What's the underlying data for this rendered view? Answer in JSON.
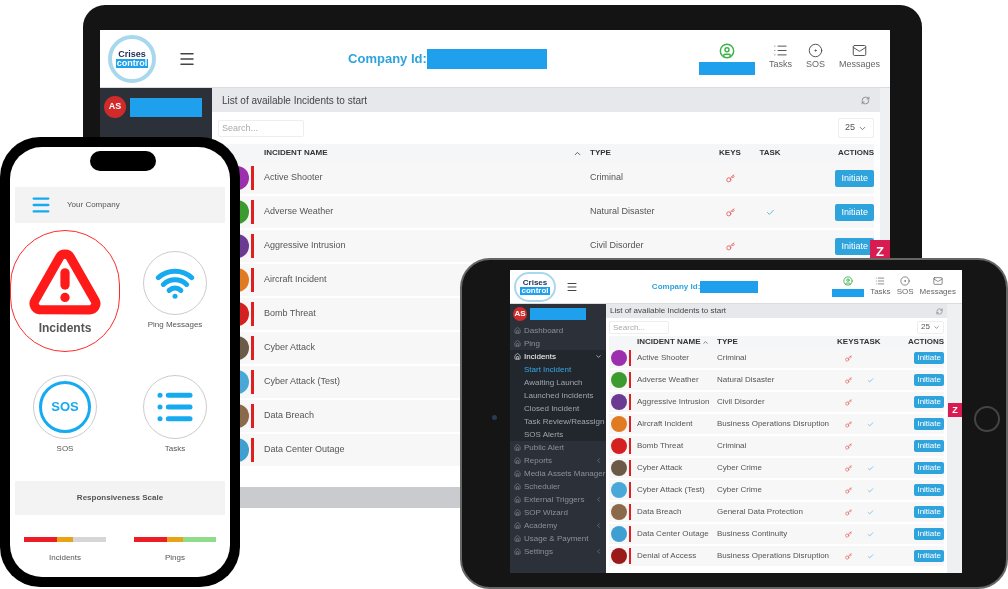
{
  "laptop": {
    "logo_text": [
      "Crises",
      "control"
    ],
    "company_label": "Company Id:",
    "nav": [
      {
        "kind": "user"
      },
      {
        "kind": "tasks",
        "label": "Tasks"
      },
      {
        "kind": "sos",
        "label": "SOS"
      },
      {
        "kind": "messages",
        "label": "Messages"
      }
    ],
    "user": {
      "initials": "AS"
    },
    "panel": {
      "title": "List of available Incidents to start",
      "search_placeholder": "Search...",
      "page_size": "25"
    },
    "columns": [
      "INCIDENT NAME",
      "TYPE",
      "KEYS",
      "TASK",
      "ACTIONS"
    ],
    "rows": [
      {
        "name": "Active Shooter",
        "color": "#9b2fae",
        "type": "Criminal",
        "key": true,
        "task": false,
        "action": "Initiate"
      },
      {
        "name": "Adverse Weather",
        "color": "#3c9b2e",
        "type": "Natural Disaster",
        "key": true,
        "task": true,
        "action": "Initiate"
      },
      {
        "name": "Aggressive Intrusion",
        "color": "#6b3b92",
        "type": "Civil Disorder",
        "key": true,
        "task": false,
        "action": "Initiate"
      },
      {
        "name": "Aircraft Incident",
        "color": "#e07b22"
      },
      {
        "name": "Bomb Threat",
        "color": "#d42020"
      },
      {
        "name": "Cyber Attack",
        "color": "#6b5a48"
      },
      {
        "name": "Cyber Attack (Test)",
        "color": "#4aa8d8"
      },
      {
        "name": "Data Breach",
        "color": "#8a6a4a"
      },
      {
        "name": "Data Center Outage",
        "color": "#3f9fd0"
      }
    ],
    "widget": "Z"
  },
  "phone": {
    "company": "Your Company",
    "tiles": [
      {
        "kind": "incidents",
        "label": "Incidents",
        "selected": true
      },
      {
        "kind": "ping",
        "label": "Ping Messages",
        "selected": false
      },
      {
        "kind": "sos",
        "label": "SOS",
        "icon_text": "SOS",
        "selected": false
      },
      {
        "kind": "tasks",
        "label": "Tasks",
        "selected": false
      }
    ],
    "scale_title": "Responsiveness Scale",
    "scales": [
      {
        "label": "Incidents",
        "color": "#d6d6d6",
        "fills": [
          {
            "color": "#ee1c25",
            "level": 0.4
          },
          {
            "color": "#e8a317",
            "level": 0.6
          }
        ]
      },
      {
        "label": "Pings",
        "color": "#8fdc8a",
        "fills": [
          {
            "color": "#ee1c25",
            "level": 0.4
          },
          {
            "color": "#e8a317",
            "level": 0.6
          }
        ]
      }
    ]
  },
  "tablet": {
    "logo_text": [
      "Crises",
      "control"
    ],
    "company_label": "Company Id:",
    "nav": [
      {
        "kind": "user"
      },
      {
        "kind": "tasks",
        "label": "Tasks"
      },
      {
        "kind": "sos",
        "label": "SOS"
      },
      {
        "kind": "messages",
        "label": "Messages"
      }
    ],
    "user": {
      "initials": "AS"
    },
    "menu": [
      {
        "label": "Dashboard"
      },
      {
        "label": "Ping"
      },
      {
        "label": "Incidents",
        "expanded": true,
        "children": [
          {
            "label": "Start Incident",
            "selected": true
          },
          {
            "label": "Awaiting Launch",
            "selected": false
          },
          {
            "label": "Launched Incidents",
            "selected": false
          },
          {
            "label": "Closed Incident",
            "selected": false
          },
          {
            "label": "Task Review/Reassign",
            "selected": false
          },
          {
            "label": "SOS Alerts",
            "selected": false
          }
        ]
      },
      {
        "label": "Public Alert"
      },
      {
        "label": "Reports",
        "expanded": false
      },
      {
        "label": "Media Assets Manager"
      },
      {
        "label": "Scheduler"
      },
      {
        "label": "External Triggers",
        "expanded": false
      },
      {
        "label": "SOP Wizard"
      },
      {
        "label": "Academy",
        "expanded": false
      },
      {
        "label": "Usage & Payment"
      },
      {
        "label": "Settings",
        "expanded": false
      }
    ],
    "panel": {
      "title": "List of available Incidents to start",
      "search_placeholder": "Search...",
      "page_size": "25"
    },
    "columns": [
      "INCIDENT NAME",
      "TYPE",
      "KEYS",
      "TASK",
      "ACTIONS"
    ],
    "rows": [
      {
        "name": "Active Shooter",
        "color": "#9b2fae",
        "type": "Criminal",
        "key": true,
        "task": false,
        "action": "Initiate"
      },
      {
        "name": "Adverse Weather",
        "color": "#3c9b2e",
        "type": "Natural Disaster",
        "key": true,
        "task": true,
        "action": "Initiate"
      },
      {
        "name": "Aggressive Intrusion",
        "color": "#6b3b92",
        "type": "Civil Disorder",
        "key": true,
        "task": false,
        "action": "Initiate"
      },
      {
        "name": "Aircraft Incident",
        "color": "#e07b22",
        "type": "Business Operations Disruption",
        "key": true,
        "task": true,
        "action": "Initiate"
      },
      {
        "name": "Bomb Threat",
        "color": "#d42020",
        "type": "Criminal",
        "key": true,
        "task": false,
        "action": "Initiate"
      },
      {
        "name": "Cyber Attack",
        "color": "#6b5a48",
        "type": "Cyber Crime",
        "key": true,
        "task": true,
        "action": "Initiate"
      },
      {
        "name": "Cyber Attack (Test)",
        "color": "#4aa8d8",
        "type": "Cyber Crime",
        "key": true,
        "task": true,
        "action": "Initiate"
      },
      {
        "name": "Data Breach",
        "color": "#8a6a4a",
        "type": "General Data Protection",
        "key": true,
        "task": true,
        "action": "Initiate"
      },
      {
        "name": "Data Center Outage",
        "color": "#3f9fd0",
        "type": "Business Continuity",
        "key": true,
        "task": true,
        "action": "Initiate"
      },
      {
        "name": "Denial of Access",
        "color": "#9a1a1a",
        "type": "Business Operations Disruption",
        "key": true,
        "task": true,
        "action": "Initiate"
      }
    ],
    "widget": "Z"
  }
}
